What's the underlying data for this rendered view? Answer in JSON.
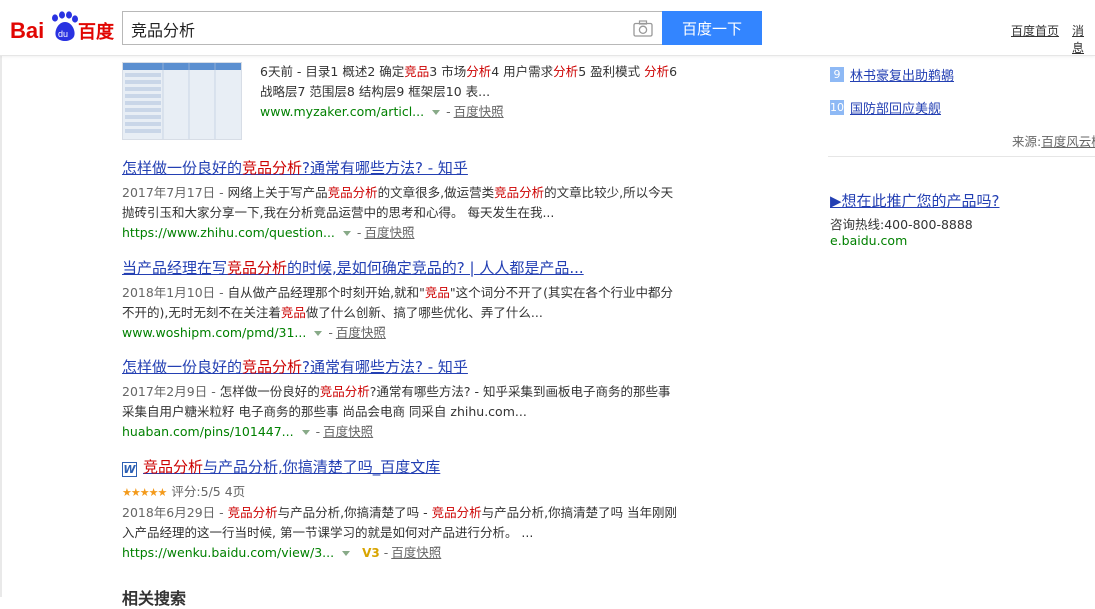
{
  "header": {
    "search_value": "竞品分析",
    "search_button": "百度一下",
    "nav": [
      "百度首页",
      "消息"
    ]
  },
  "results": [
    {
      "title_plain": "",
      "abstract": [
        {
          "t": "6天前 - 目录1 概述2 确定"
        },
        {
          "t": "竞品",
          "em": true
        },
        {
          "t": "3 市场"
        },
        {
          "t": "分析",
          "em": true
        },
        {
          "t": "4 用户需求"
        },
        {
          "t": "分析",
          "em": true
        },
        {
          "t": "5 盈利模式 "
        },
        {
          "t": "分析",
          "em": true
        },
        {
          "t": "6 战略层7 范围层8 结构层9 框架层10 表..."
        }
      ],
      "url": "www.myzaker.com/articl...",
      "cache": "百度快照"
    },
    {
      "title": [
        {
          "t": "怎样做一份良好的"
        },
        {
          "t": "竞品分析",
          "em": true
        },
        {
          "t": "?通常有哪些方法? - 知乎"
        }
      ],
      "abstract": [
        {
          "t": "2017年7月17日 - ",
          "date": true
        },
        {
          "t": "网络上关于写产品"
        },
        {
          "t": "竞品分析",
          "em": true
        },
        {
          "t": "的文章很多,做运营类"
        },
        {
          "t": "竞品分析",
          "em": true
        },
        {
          "t": "的文章比较少,所以今天抛砖引玉和大家分享一下,我在分析竞品运营中的思考和心得。 每天发生在我..."
        }
      ],
      "url": "https://www.zhihu.com/question...",
      "cache": "百度快照"
    },
    {
      "title": [
        {
          "t": "当产品经理在写"
        },
        {
          "t": "竞品分析",
          "em": true
        },
        {
          "t": "的时候,是如何确定竞品的? | 人人都是产品..."
        }
      ],
      "abstract": [
        {
          "t": "2018年1月10日 - ",
          "date": true
        },
        {
          "t": "自从做产品经理那个时刻开始,就和\""
        },
        {
          "t": "竞品",
          "em": true
        },
        {
          "t": "\"这个词分不开了(其实在各个行业中都分不开的),无时无刻不在关注着"
        },
        {
          "t": "竞品",
          "em": true
        },
        {
          "t": "做了什么创新、搞了哪些优化、弄了什么..."
        }
      ],
      "url": "www.woshipm.com/pmd/31...",
      "cache": "百度快照"
    },
    {
      "title": [
        {
          "t": "怎样做一份良好的"
        },
        {
          "t": "竞品分析",
          "em": true
        },
        {
          "t": "?通常有哪些方法? - 知乎"
        }
      ],
      "abstract": [
        {
          "t": "2017年2月9日 - ",
          "date": true
        },
        {
          "t": "怎样做一份良好的"
        },
        {
          "t": "竞品分析",
          "em": true
        },
        {
          "t": "?通常有哪些方法? - 知乎采集到画板电子商务的那些事 采集自用户糖米粒籽 电子商务的那些事 尚品会电商 同采自 zhihu.com..."
        }
      ],
      "url": "huaban.com/pins/101447...",
      "cache": "百度快照"
    },
    {
      "title": [
        {
          "t": "竞品分析",
          "em": true
        },
        {
          "t": "与产品分析,你搞清楚了吗_百度文库"
        }
      ],
      "rating_stars": "★★★★★",
      "rating_text": "评分:5/5 4页",
      "abstract": [
        {
          "t": "2018年6月29日 - ",
          "date": true
        },
        {
          "t": "竞品分析",
          "em": true
        },
        {
          "t": "与产品分析,你搞清楚了吗 - "
        },
        {
          "t": "竞品分析",
          "em": true
        },
        {
          "t": "与产品分析,你搞清楚了吗 当年刚刚入产品经理的这一行当时候, 第一节课学习的就是如何对产品进行分析。 ..."
        }
      ],
      "url": "https://wenku.baidu.com/view/3...",
      "badge": "V3",
      "cache": "百度快照"
    }
  ],
  "sidebar": {
    "hot": [
      {
        "num": "9",
        "text": "林书豪复出助鹈鹕"
      },
      {
        "num": "10",
        "text": "国防部回应美舰"
      }
    ],
    "source_label": "来源:",
    "source_link": "百度风云榜",
    "promo_title": "▶想在此推广您的产品吗?",
    "promo_phone": "咨询热线:400-800-8888",
    "promo_url": "e.baidu.com"
  },
  "related_title": "相关搜索",
  "colors": {
    "accent": "#3385ff",
    "link": "#2440b3",
    "highlight": "#c00",
    "url": "#008000"
  }
}
